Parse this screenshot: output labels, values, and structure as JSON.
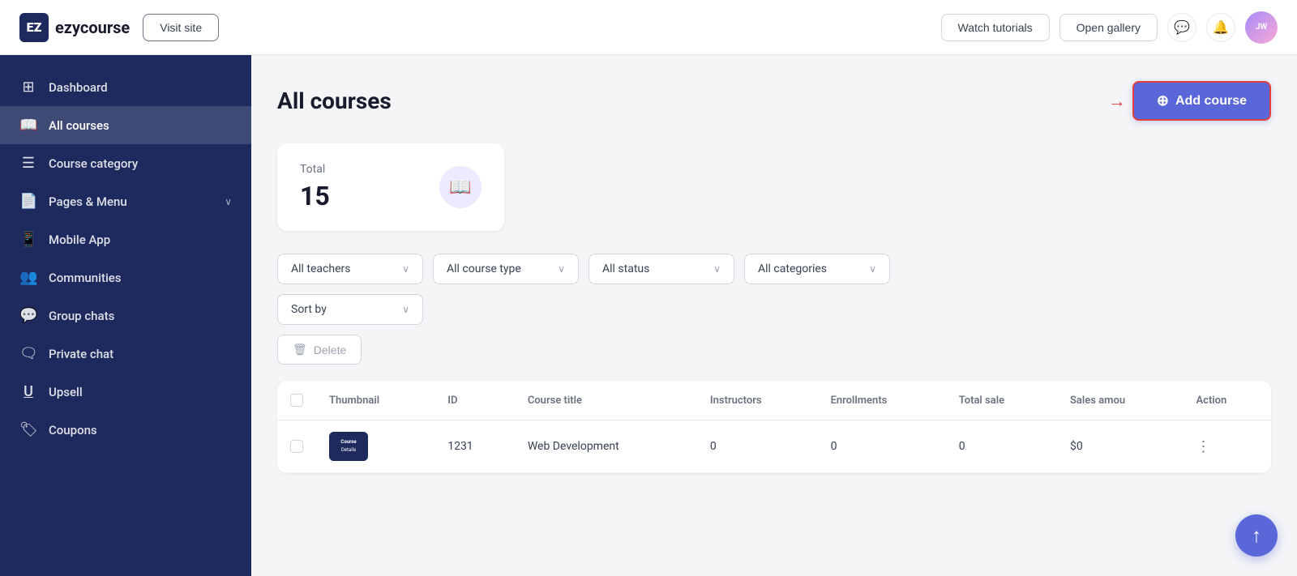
{
  "app": {
    "logo_text": "ezycourse",
    "logo_abbr": "EZ"
  },
  "topbar": {
    "visit_site": "Visit site",
    "watch_tutorials": "Watch tutorials",
    "open_gallery": "Open gallery",
    "avatar_text": "JW"
  },
  "sidebar": {
    "items": [
      {
        "id": "dashboard",
        "label": "Dashboard",
        "icon": "⊞"
      },
      {
        "id": "all-courses",
        "label": "All courses",
        "icon": "📖",
        "active": true
      },
      {
        "id": "course-category",
        "label": "Course category",
        "icon": "☰"
      },
      {
        "id": "pages-menu",
        "label": "Pages & Menu",
        "icon": "📄",
        "has_arrow": true
      },
      {
        "id": "mobile-app",
        "label": "Mobile App",
        "icon": "📱"
      },
      {
        "id": "communities",
        "label": "Communities",
        "icon": "👥"
      },
      {
        "id": "group-chats",
        "label": "Group chats",
        "icon": "💬"
      },
      {
        "id": "private-chat",
        "label": "Private chat",
        "icon": "🗨"
      },
      {
        "id": "upsell",
        "label": "Upsell",
        "icon": "↑"
      },
      {
        "id": "coupons",
        "label": "Coupons",
        "icon": "🏷"
      }
    ]
  },
  "main": {
    "page_title": "All courses",
    "add_course_label": "Add course",
    "stats": {
      "label": "Total",
      "value": "15"
    },
    "filters": {
      "all_teachers": "All teachers",
      "all_course_type": "All course type",
      "all_status": "All status",
      "all_categories": "All categories",
      "sort_by": "Sort by"
    },
    "delete_label": "Delete",
    "table": {
      "columns": [
        "Thumbnail",
        "ID",
        "Course title",
        "Instructors",
        "Enrollments",
        "Total sale",
        "Sales amou",
        "Action"
      ],
      "rows": [
        {
          "id": "1231",
          "title": "Web Development",
          "instructors": "0",
          "enrollments": "0",
          "total_sale": "0",
          "sales_amount": "$0"
        }
      ]
    }
  }
}
